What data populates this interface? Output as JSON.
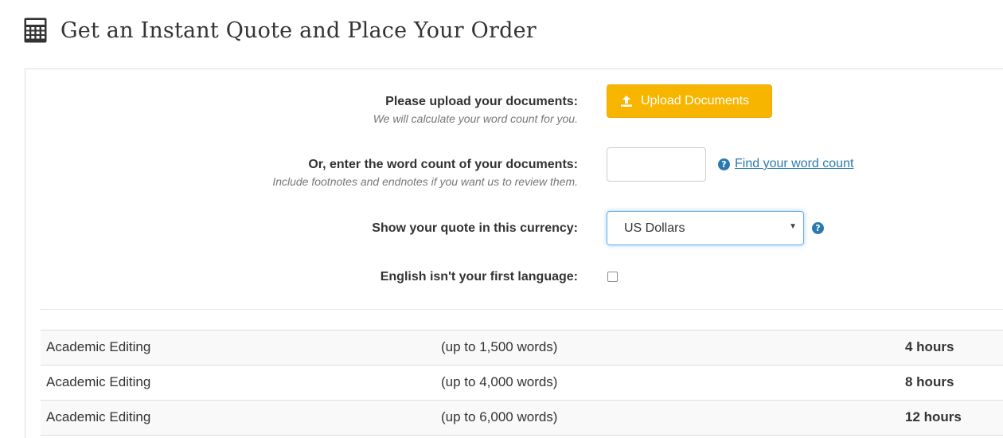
{
  "header": {
    "title": "Get an Instant Quote and Place Your Order",
    "icon": "calculator-icon"
  },
  "upload": {
    "label": "Please upload your documents:",
    "hint": "We will calculate your word count for you.",
    "button_label": "Upload Documents",
    "button_icon": "upload-icon",
    "button_color": "#f8b500"
  },
  "word_count": {
    "label": "Or, enter the word count of your documents:",
    "hint": "Include footnotes and endnotes if you want us to review them.",
    "value": "",
    "placeholder": "",
    "help_link": "Find your word count",
    "help_icon": "question-circle-icon"
  },
  "currency": {
    "label": "Show your quote in this currency:",
    "selected": "US Dollars",
    "help_icon": "question-circle-icon"
  },
  "language": {
    "label": "English isn't your first language:",
    "checked": false
  },
  "quotes": [
    {
      "service": "Academic Editing",
      "words": "(up to 1,500 words)",
      "time": "4 hours"
    },
    {
      "service": "Academic Editing",
      "words": "(up to 4,000 words)",
      "time": "8 hours"
    },
    {
      "service": "Academic Editing",
      "words": "(up to 6,000 words)",
      "time": "12 hours"
    }
  ],
  "colors": {
    "accent_link": "#2a7ab0",
    "focus_border": "#66afe9"
  }
}
